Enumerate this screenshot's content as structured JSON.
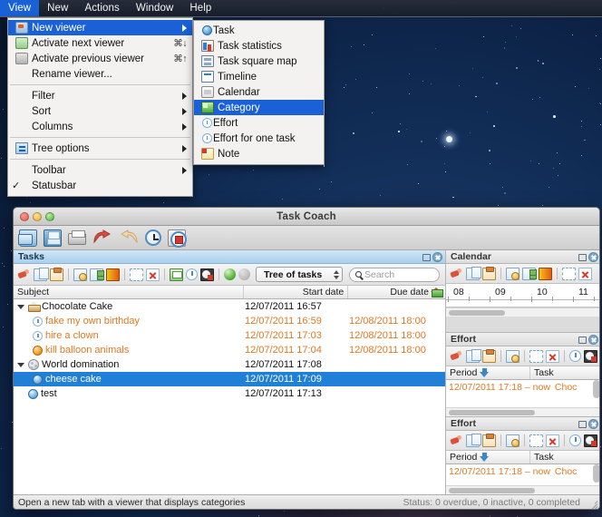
{
  "menubar": {
    "items": [
      {
        "label": "View",
        "active": true
      },
      {
        "label": "New",
        "active": false
      },
      {
        "label": "Actions",
        "active": false
      },
      {
        "label": "Window",
        "active": false
      },
      {
        "label": "Help",
        "active": false
      }
    ]
  },
  "view_menu": {
    "items": [
      {
        "label": "New viewer",
        "shortcut": "",
        "icon": "new-viewer-icon",
        "submenu": true,
        "selected": true
      },
      {
        "label": "Activate next viewer",
        "shortcut": "⌘↓",
        "icon": "next-viewer-icon",
        "submenu": false,
        "selected": false
      },
      {
        "label": "Activate previous viewer",
        "shortcut": "⌘↑",
        "icon": "previous-viewer-icon",
        "submenu": false,
        "selected": false
      },
      {
        "label": "Rename viewer...",
        "shortcut": "",
        "icon": "",
        "submenu": false,
        "selected": false
      },
      {
        "label": "Filter",
        "shortcut": "",
        "icon": "",
        "submenu": true,
        "selected": false
      },
      {
        "label": "Sort",
        "shortcut": "",
        "icon": "",
        "submenu": true,
        "selected": false
      },
      {
        "label": "Columns",
        "shortcut": "",
        "icon": "",
        "submenu": true,
        "selected": false
      },
      {
        "label": "Tree options",
        "shortcut": "",
        "icon": "tree-options-icon",
        "submenu": true,
        "selected": false
      },
      {
        "label": "Toolbar",
        "shortcut": "",
        "icon": "",
        "submenu": true,
        "selected": false
      },
      {
        "label": "Statusbar",
        "shortcut": "",
        "icon": "",
        "submenu": false,
        "selected": false,
        "checked": true
      }
    ],
    "check_glyph": "✓"
  },
  "viewer_submenu": {
    "items": [
      {
        "label": "Task",
        "icon": "task-icon",
        "selected": false
      },
      {
        "label": "Task statistics",
        "icon": "task-statistics-icon",
        "selected": false
      },
      {
        "label": "Task square map",
        "icon": "task-square-map-icon",
        "selected": false
      },
      {
        "label": "Timeline",
        "icon": "timeline-icon",
        "selected": false
      },
      {
        "label": "Calendar",
        "icon": "calendar-icon",
        "selected": false
      },
      {
        "label": "Category",
        "icon": "category-icon",
        "selected": true
      },
      {
        "label": "Effort",
        "icon": "effort-icon",
        "selected": false
      },
      {
        "label": "Effort for one task",
        "icon": "effort-one-task-icon",
        "selected": false
      },
      {
        "label": "Note",
        "icon": "note-icon",
        "selected": false
      }
    ]
  },
  "window": {
    "title": "Task Coach",
    "toolbar": [
      {
        "name": "open-button",
        "icon": "open-folder-icon"
      },
      {
        "name": "save-button",
        "icon": "save-icon"
      },
      {
        "name": "print-button",
        "icon": "print-icon"
      },
      {
        "name": "undo-button",
        "icon": "undo-arrow-icon"
      },
      {
        "name": "redo-button",
        "icon": "redo-arrow-icon"
      },
      {
        "name": "start-tracking-button",
        "icon": "clock-icon"
      },
      {
        "name": "stop-tracking-button",
        "icon": "clock-stop-icon"
      }
    ]
  },
  "tasks_pane": {
    "title": "Tasks",
    "combo_value": "Tree of tasks",
    "search_placeholder": "Search",
    "columns": [
      "Subject",
      "Start date",
      "Due date"
    ],
    "rows": [
      {
        "subject": "Chocolate Cake",
        "icon": "cake-icon",
        "start": "12/07/2011 16:57",
        "due": "",
        "level": 0,
        "expander": true,
        "overdue": false,
        "selected": false
      },
      {
        "subject": "fake my own birthday",
        "icon": "clock-icon",
        "start": "12/07/2011 16:59",
        "due": "12/08/2011 18:00",
        "level": 1,
        "expander": false,
        "overdue": true,
        "selected": false
      },
      {
        "subject": "hire a clown",
        "icon": "clock-icon",
        "start": "12/07/2011 17:03",
        "due": "12/08/2011 18:00",
        "level": 1,
        "expander": false,
        "overdue": true,
        "selected": false
      },
      {
        "subject": "kill balloon animals",
        "icon": "orange-ball-icon",
        "start": "12/07/2011 17:04",
        "due": "12/08/2011 18:00",
        "level": 1,
        "expander": false,
        "overdue": true,
        "selected": false
      },
      {
        "subject": "World domination",
        "icon": "globe-icon",
        "start": "12/07/2011 17:08",
        "due": "",
        "level": 0,
        "expander": true,
        "overdue": false,
        "selected": false
      },
      {
        "subject": "cheese cake",
        "icon": "sphere-icon",
        "start": "12/07/2011 17:09",
        "due": "",
        "level": 1,
        "expander": false,
        "overdue": false,
        "selected": true
      },
      {
        "subject": "test",
        "icon": "sphere-icon",
        "start": "12/07/2011 17:13",
        "due": "",
        "level": 0,
        "expander": false,
        "overdue": false,
        "selected": false
      }
    ]
  },
  "calendar_pane": {
    "title": "Calendar",
    "day_ticks": [
      "08",
      "09",
      "10",
      "11"
    ]
  },
  "effort_pane_1": {
    "title": "Effort",
    "columns": [
      "Period",
      "Task"
    ],
    "rows": [
      {
        "period": "12/07/2011 17:18 – now",
        "task": "Choc"
      }
    ]
  },
  "effort_pane_2": {
    "title": "Effort",
    "columns": [
      "Period",
      "Task"
    ],
    "rows": [
      {
        "period": "12/07/2011 17:18 – now",
        "task": "Choc"
      }
    ]
  },
  "statusbar": {
    "hint": "Open a new tab with a viewer that displays categories",
    "status": "Status: 0 overdue, 0 inactive, 0 completed"
  },
  "colors": {
    "accent": "#1a61d8",
    "selection": "#2080d8",
    "overdue": "#e07820",
    "desktop": "#13315c"
  }
}
